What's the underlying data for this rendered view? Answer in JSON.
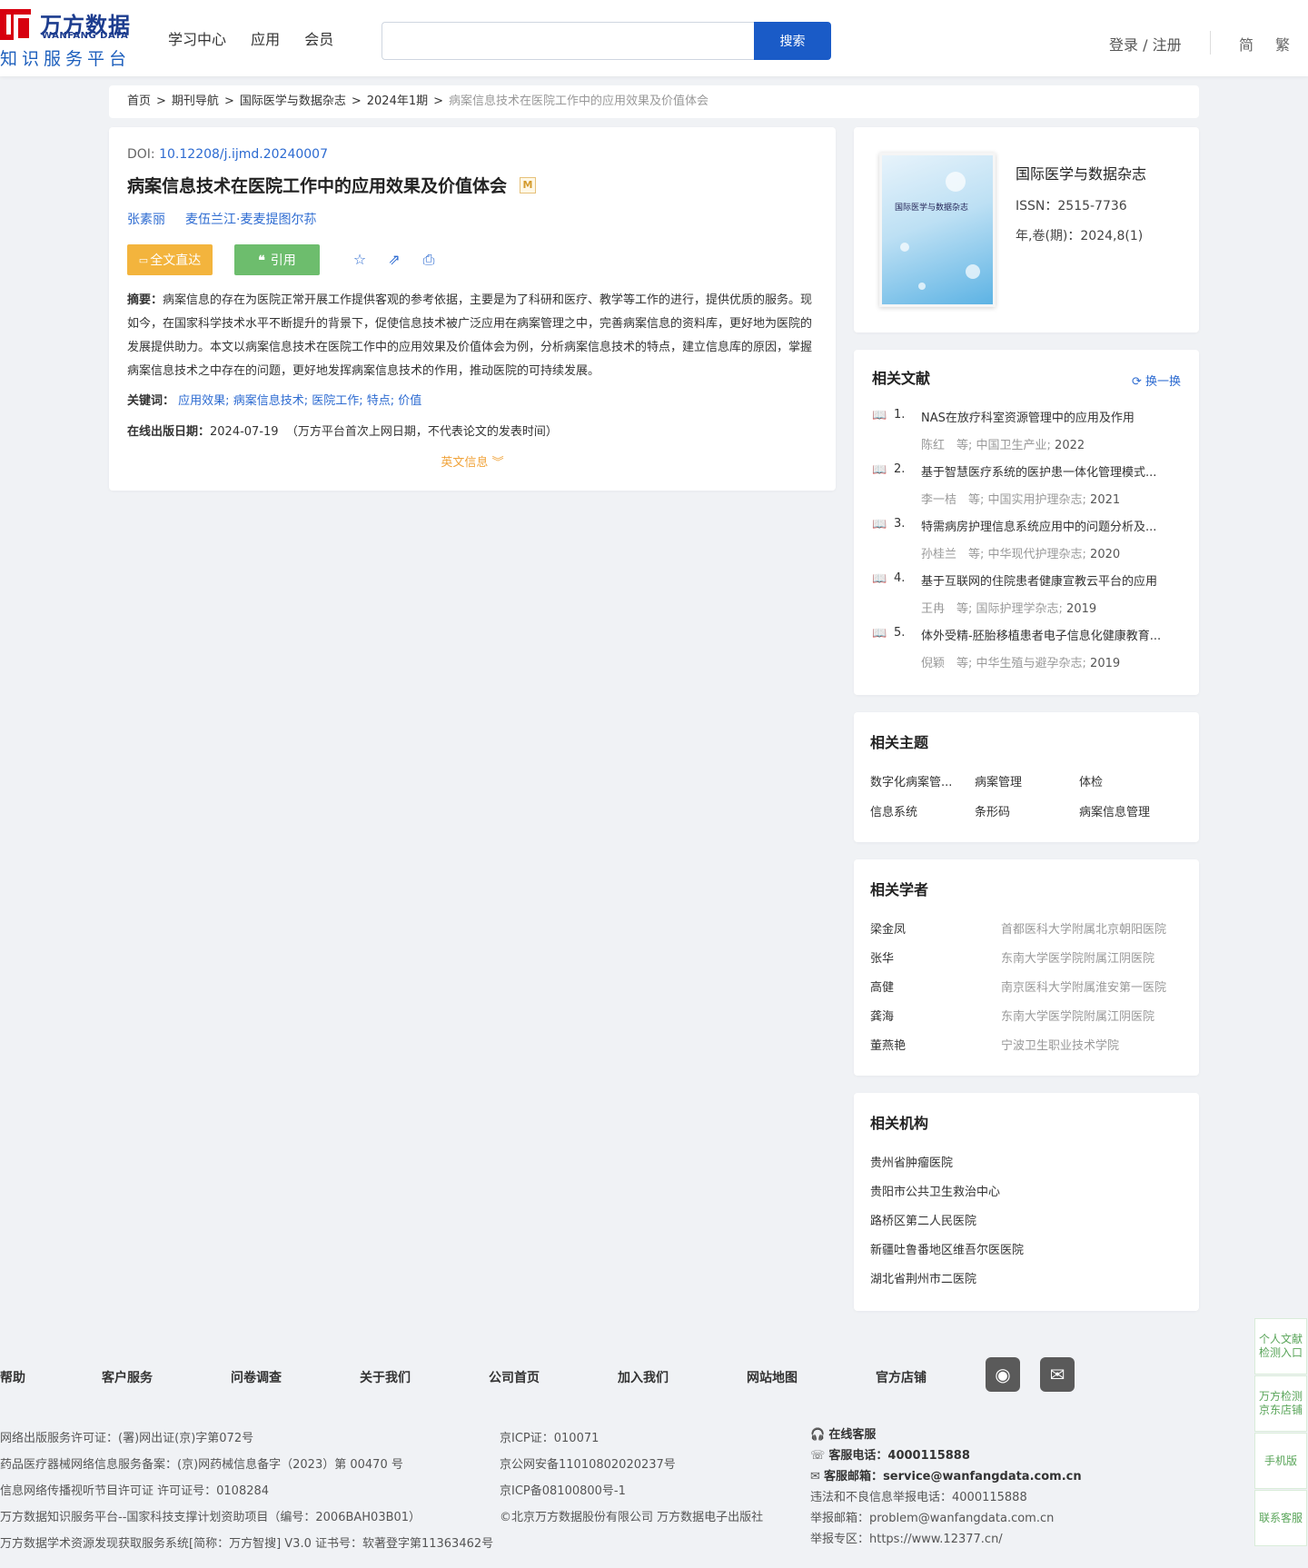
{
  "header": {
    "logo_cn": "万方数据",
    "logo_en": "WANFANG DATA",
    "logo_sub": "知识服务平台",
    "nav": [
      "学习中心",
      "应用",
      "会员"
    ],
    "search_placeholder": "",
    "search_button": "搜索",
    "login": "登录 / 注册",
    "lang_simplified": "简",
    "lang_traditional": "繁"
  },
  "breadcrumb": {
    "items": [
      "首页",
      "期刊导航",
      "国际医学与数据杂志",
      "2024年1期"
    ],
    "current": "病案信息技术在医院工作中的应用效果及价值体会",
    "sep": ">"
  },
  "article": {
    "doi_label": "DOI: ",
    "doi": "10.12208/j.ijmd.20240007",
    "title": "病案信息技术在医院工作中的应用效果及价值体会",
    "m_badge": "M",
    "authors": [
      "张素丽",
      "麦伍兰江·麦麦提图尔荪"
    ],
    "btn_fulltext": "全文直达",
    "btn_cite": "引用",
    "abstract_label": "摘要：",
    "abstract": "病案信息的存在为医院正常开展工作提供客观的参考依据，主要是为了科研和医疗、教学等工作的进行，提供优质的服务。现如今，在国家科学技术水平不断提升的背景下，促使信息技术被广泛应用在病案管理之中，完善病案信息的资料库，更好地为医院的发展提供助力。本文以病案信息技术在医院工作中的应用效果及价值体会为例，分析病案信息技术的特点，建立信息库的原因，掌握病案信息技术之中存在的问题，更好地发挥病案信息技术的作用，推动医院的可持续发展。",
    "keywords_label": "关键词：",
    "keywords": [
      "应用效果;",
      "病案信息技术;",
      "医院工作;",
      "特点;",
      "价值"
    ],
    "pubdate_label": "在线出版日期：",
    "pubdate": "2024-07-19",
    "pubdate_note": "（万方平台首次上网日期，不代表论文的发表时间）",
    "en_info": "英文信息"
  },
  "journal": {
    "cover_title": "国际医学与数据杂志",
    "title": "国际医学与数据杂志",
    "issn": "ISSN：2515-7736",
    "volume": "年,卷(期)：2024,8(1)"
  },
  "related_literature": {
    "title": "相关文献",
    "refresh": "换一换",
    "items": [
      {
        "num": "1.",
        "title": "NAS在放疗科室资源管理中的应用及作用",
        "meta": "陈红　等;  中国卫生产业;",
        "year": "2022"
      },
      {
        "num": "2.",
        "title": "基于智慧医疗系统的医护患一体化管理模式...",
        "meta": "李一桔　等;  中国实用护理杂志;",
        "year": "2021"
      },
      {
        "num": "3.",
        "title": "特需病房护理信息系统应用中的问题分析及...",
        "meta": "孙桂兰　等;  中华现代护理杂志;",
        "year": "2020"
      },
      {
        "num": "4.",
        "title": "基于互联网的住院患者健康宣教云平台的应用",
        "meta": "王冉　等;  国际护理学杂志;",
        "year": "2019"
      },
      {
        "num": "5.",
        "title": "体外受精-胚胎移植患者电子信息化健康教育...",
        "meta": "倪颖　等;  中华生殖与避孕杂志;",
        "year": "2019"
      }
    ]
  },
  "related_topics": {
    "title": "相关主题",
    "items": [
      "数字化病案管...",
      "病案管理",
      "体检",
      "信息系统",
      "条形码",
      "病案信息管理"
    ]
  },
  "related_scholars": {
    "title": "相关学者",
    "items": [
      {
        "name": "梁金凤",
        "org": "首都医科大学附属北京朝阳医院"
      },
      {
        "name": "张华",
        "org": "东南大学医学院附属江阴医院"
      },
      {
        "name": "高健",
        "org": "南京医科大学附属淮安第一医院"
      },
      {
        "name": "龚海",
        "org": "东南大学医学院附属江阴医院"
      },
      {
        "name": "董燕艳",
        "org": "宁波卫生职业技术学院"
      }
    ]
  },
  "related_institutions": {
    "title": "相关机构",
    "items": [
      "贵州省肿瘤医院",
      "贵阳市公共卫生救治中心",
      "路桥区第二人民医院",
      "新疆吐鲁番地区维吾尔医医院",
      "湖北省荆州市二医院"
    ]
  },
  "footer": {
    "links": [
      "帮助",
      "客户服务",
      "问卷调查",
      "关于我们",
      "公司首页",
      "加入我们",
      "网站地图",
      "官方店铺"
    ],
    "col1": [
      "网络出版服务许可证：(署)网出证(京)字第072号",
      "药品医疗器械网络信息服务备案：(京)网药械信息备字（2023）第 00470 号",
      "信息网络传播视听节目许可证 许可证号：0108284",
      "万方数据知识服务平台--国家科技支撑计划资助项目（编号：2006BAH03B01）",
      "万方数据学术资源发现获取服务系统[简称：万方智搜] V3.0 证书号：软著登字第11363462号"
    ],
    "col2": [
      "京ICP证：010071",
      "京公网安备11010802020237号",
      "京ICP备08100800号-1",
      "©北京万方数据股份有限公司 万方数据电子出版社"
    ],
    "col3_online": "在线客服",
    "col3_phone_label": "客服电话：",
    "col3_phone": "4000115888",
    "col3_email_label": "客服邮箱：",
    "col3_email": "service@wanfangdata.com.cn",
    "col3_rest": [
      "违法和不良信息举报电话：4000115888",
      "举报邮箱：problem@wanfangdata.com.cn",
      "举报专区：https://www.12377.cn/"
    ]
  },
  "float_side": {
    "items": [
      "个人文献检测入口",
      "万方检测京东店铺",
      "手机版",
      "联系客服"
    ]
  }
}
